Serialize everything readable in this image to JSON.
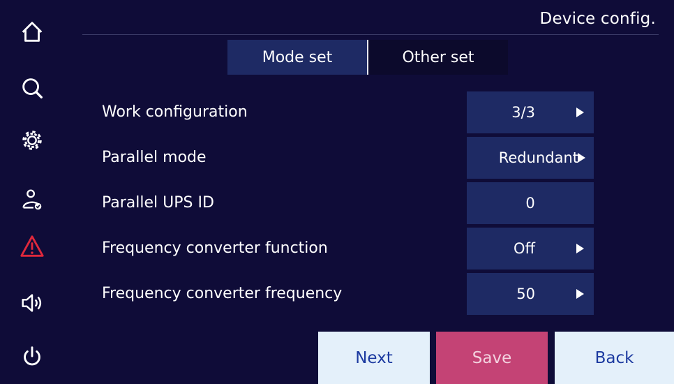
{
  "header": {
    "title": "Device config."
  },
  "sidebar": {
    "items": [
      {
        "icon": "home-icon"
      },
      {
        "icon": "search-icon"
      },
      {
        "icon": "gear-icon"
      },
      {
        "icon": "user-check-icon"
      },
      {
        "icon": "warning-icon",
        "color": "#e0283c"
      },
      {
        "icon": "speaker-icon"
      },
      {
        "icon": "power-icon"
      }
    ]
  },
  "tabs": [
    {
      "label": "Mode set",
      "active": true
    },
    {
      "label": "Other set",
      "active": false
    }
  ],
  "settings": [
    {
      "label": "Work configuration",
      "value": "3/3",
      "has_arrow": true
    },
    {
      "label": "Parallel mode",
      "value": "Redundant",
      "has_arrow": true
    },
    {
      "label": "Parallel UPS ID",
      "value": "0",
      "has_arrow": false
    },
    {
      "label": "Frequency converter function",
      "value": "Off",
      "has_arrow": true
    },
    {
      "label": "Frequency converter frequency",
      "value": "50",
      "has_arrow": true
    }
  ],
  "buttons": {
    "next": "Next",
    "save": "Save",
    "back": "Back"
  },
  "colors": {
    "background": "#0f0c38",
    "panel": "#1e2a64",
    "save": "#c44375",
    "light_button": "#e4f0fa",
    "alert": "#e0283c"
  }
}
